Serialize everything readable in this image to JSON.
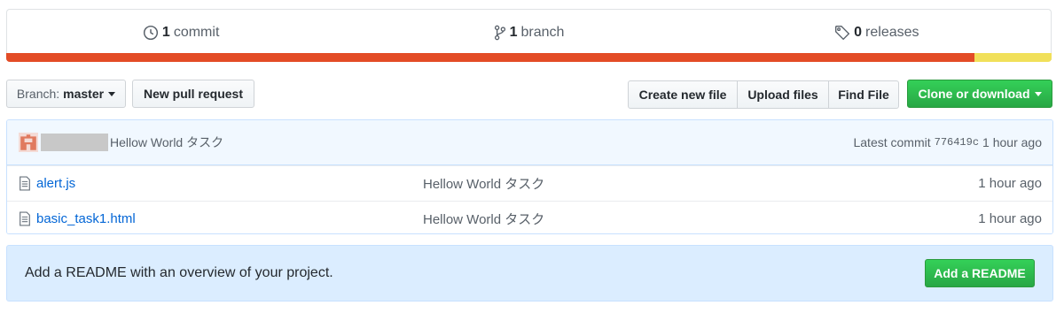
{
  "summary": {
    "commits": {
      "count": "1",
      "label": "commit",
      "icon": "history-icon"
    },
    "branches": {
      "count": "1",
      "label": "branch",
      "icon": "git-branch-icon"
    },
    "releases": {
      "count": "0",
      "label": "releases",
      "icon": "tag-icon"
    }
  },
  "language_bar": [
    {
      "color": "#e34c26",
      "percent": 92.6
    },
    {
      "color": "#f1e05a",
      "percent": 7.4
    }
  ],
  "toolbar": {
    "branch_prefix": "Branch:",
    "branch_name": "master",
    "new_pull_request": "New pull request",
    "create_new_file": "Create new file",
    "upload_files": "Upload files",
    "find_file": "Find File",
    "clone_or_download": "Clone or download"
  },
  "latest_commit": {
    "message": "Hellow World タスク",
    "prefix": "Latest commit",
    "sha": "776419c",
    "age": "1 hour ago"
  },
  "files": [
    {
      "name": "alert.js",
      "message": "Hellow World タスク",
      "age": "1 hour ago"
    },
    {
      "name": "basic_task1.html",
      "message": "Hellow World タスク",
      "age": "1 hour ago"
    }
  ],
  "readme_prompt": {
    "message": "Add a README with an overview of your project.",
    "button": "Add a README"
  },
  "colors": {
    "link": "#0366d6",
    "primary_button": "#28a745"
  }
}
